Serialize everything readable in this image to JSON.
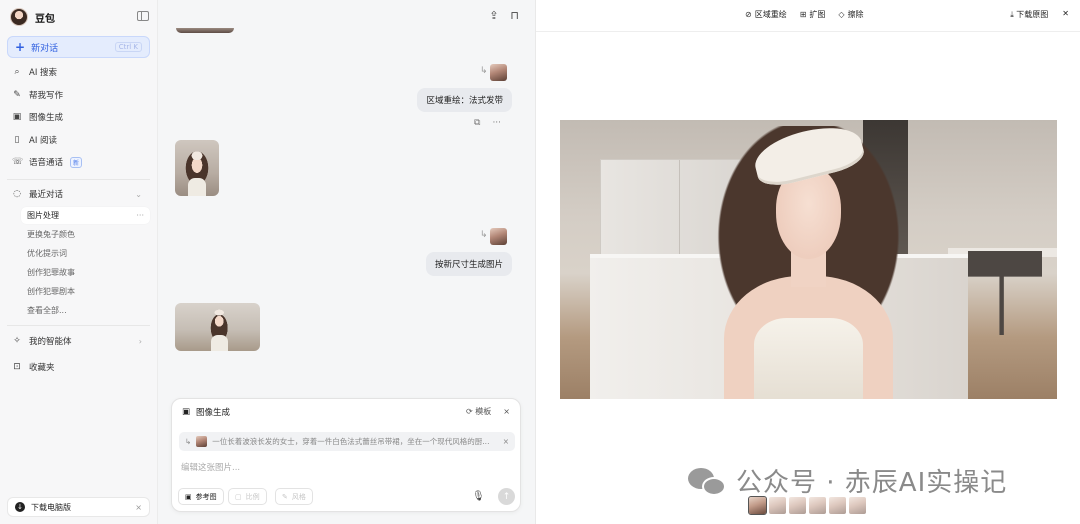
{
  "sidebar": {
    "brand": "豆包",
    "new_chat": {
      "label": "新对话",
      "shortcut": "Ctrl K"
    },
    "nav": [
      {
        "icon": "search-icon",
        "label": "AI 搜索"
      },
      {
        "icon": "pen-icon",
        "label": "帮我写作"
      },
      {
        "icon": "image-icon",
        "label": "图像生成"
      },
      {
        "icon": "book-icon",
        "label": "AI 阅读"
      },
      {
        "icon": "phone-icon",
        "label": "语音通话",
        "badge": "新"
      }
    ],
    "recent": {
      "label": "最近对话",
      "items": [
        "图片处理",
        "更换兔子颜色",
        "优化提示词",
        "创作犯罪故事",
        "创作犯罪剧本",
        "查看全部..."
      ]
    },
    "agents_label": "我的智能体",
    "favorites_label": "收藏夹",
    "download_label": "下载电脑版"
  },
  "chat": {
    "messages": [
      {
        "role": "user",
        "text": "区域重绘：法式发带"
      },
      {
        "role": "user",
        "text": "按新尺寸生成图片"
      }
    ],
    "input": {
      "mode_label": "图像生成",
      "template_label": "模板",
      "reference_text": "一位长着波浪长发的女士，穿着一件白色法式蕾丝吊带裙，坐在一个现代风格的厨...",
      "placeholder": "编辑这张图片...",
      "chips": [
        "参考图",
        "比例",
        "风格"
      ]
    }
  },
  "preview": {
    "tools": [
      "区域重绘",
      "扩图",
      "擦除"
    ],
    "download_label": "下载原图",
    "watermark": "公众号 · 赤辰AI实操记",
    "thumbnail_count": 6,
    "active_thumbnail": 1
  },
  "colors": {
    "accent": "#2f5fe0",
    "accent_bg": "#e4ecfd",
    "sidebar_bg": "#f7f7f8",
    "chat_bg": "#f5f6f7"
  }
}
